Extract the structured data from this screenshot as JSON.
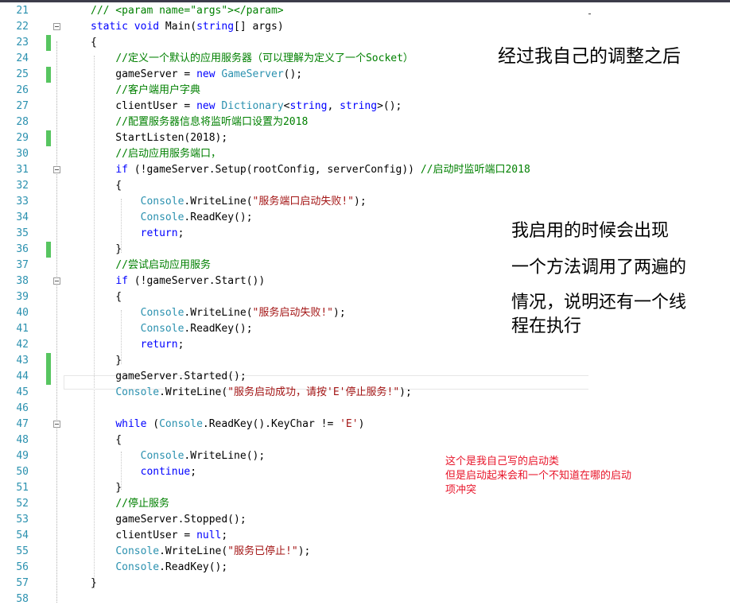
{
  "editor": {
    "lines": [
      {
        "num": "21",
        "changed": false,
        "fold": false,
        "tokens": [
          {
            "t": "/// <param name=\"args\"></param>",
            "c": "cm"
          }
        ]
      },
      {
        "num": "22",
        "changed": false,
        "fold": true,
        "tokens": [
          {
            "t": "static",
            "c": "kw"
          },
          {
            "t": " "
          },
          {
            "t": "void",
            "c": "kw"
          },
          {
            "t": " Main("
          },
          {
            "t": "string",
            "c": "kw"
          },
          {
            "t": "[] args)"
          }
        ]
      },
      {
        "num": "23",
        "changed": true,
        "fold": false,
        "tokens": [
          {
            "t": "{"
          }
        ]
      },
      {
        "num": "24",
        "changed": false,
        "fold": false,
        "tokens": [
          {
            "t": "    "
          },
          {
            "t": "//定义一个默认的应用服务器（可以理解为定义了一个Socket）",
            "c": "cm"
          }
        ]
      },
      {
        "num": "25",
        "changed": true,
        "fold": false,
        "tokens": [
          {
            "t": "    gameServer = "
          },
          {
            "t": "new",
            "c": "kw"
          },
          {
            "t": " "
          },
          {
            "t": "GameServer",
            "c": "ty"
          },
          {
            "t": "();"
          }
        ]
      },
      {
        "num": "26",
        "changed": false,
        "fold": false,
        "tokens": [
          {
            "t": "    "
          },
          {
            "t": "//客户端用户字典",
            "c": "cm"
          }
        ]
      },
      {
        "num": "27",
        "changed": false,
        "fold": false,
        "tokens": [
          {
            "t": "    clientUser = "
          },
          {
            "t": "new",
            "c": "kw"
          },
          {
            "t": " "
          },
          {
            "t": "Dictionary",
            "c": "ty"
          },
          {
            "t": "<"
          },
          {
            "t": "string",
            "c": "kw"
          },
          {
            "t": ", "
          },
          {
            "t": "string",
            "c": "kw"
          },
          {
            "t": ">();"
          }
        ]
      },
      {
        "num": "28",
        "changed": false,
        "fold": false,
        "tokens": [
          {
            "t": "    "
          },
          {
            "t": "//配置服务器信息将监听端口设置为2018",
            "c": "cm"
          }
        ]
      },
      {
        "num": "29",
        "changed": true,
        "fold": false,
        "tokens": [
          {
            "t": "    StartListen(2018);"
          }
        ]
      },
      {
        "num": "30",
        "changed": false,
        "fold": false,
        "tokens": [
          {
            "t": "    "
          },
          {
            "t": "//启动应用服务端口，",
            "c": "cm"
          }
        ]
      },
      {
        "num": "31",
        "changed": false,
        "fold": true,
        "tokens": [
          {
            "t": "    "
          },
          {
            "t": "if",
            "c": "kw"
          },
          {
            "t": " (!gameServer.Setup(rootConfig, serverConfig)) "
          },
          {
            "t": "//启动时监听端口2018",
            "c": "cm"
          }
        ]
      },
      {
        "num": "32",
        "changed": false,
        "fold": false,
        "tokens": [
          {
            "t": "    {"
          }
        ]
      },
      {
        "num": "33",
        "changed": false,
        "fold": false,
        "tokens": [
          {
            "t": "        "
          },
          {
            "t": "Console",
            "c": "ty"
          },
          {
            "t": ".WriteLine("
          },
          {
            "t": "\"服务端口启动失败!\"",
            "c": "str"
          },
          {
            "t": ");"
          }
        ]
      },
      {
        "num": "34",
        "changed": false,
        "fold": false,
        "tokens": [
          {
            "t": "        "
          },
          {
            "t": "Console",
            "c": "ty"
          },
          {
            "t": ".ReadKey();"
          }
        ]
      },
      {
        "num": "35",
        "changed": false,
        "fold": false,
        "tokens": [
          {
            "t": "        "
          },
          {
            "t": "return",
            "c": "kw"
          },
          {
            "t": ";"
          }
        ]
      },
      {
        "num": "36",
        "changed": true,
        "fold": false,
        "tokens": [
          {
            "t": "    }"
          }
        ]
      },
      {
        "num": "37",
        "changed": false,
        "fold": false,
        "tokens": [
          {
            "t": "    "
          },
          {
            "t": "//尝试启动应用服务",
            "c": "cm"
          }
        ]
      },
      {
        "num": "38",
        "changed": false,
        "fold": true,
        "tokens": [
          {
            "t": "    "
          },
          {
            "t": "if",
            "c": "kw"
          },
          {
            "t": " (!gameServer.Start())"
          }
        ]
      },
      {
        "num": "39",
        "changed": false,
        "fold": false,
        "tokens": [
          {
            "t": "    {"
          }
        ]
      },
      {
        "num": "40",
        "changed": false,
        "fold": false,
        "tokens": [
          {
            "t": "        "
          },
          {
            "t": "Console",
            "c": "ty"
          },
          {
            "t": ".WriteLine("
          },
          {
            "t": "\"服务启动失败!\"",
            "c": "str"
          },
          {
            "t": ");"
          }
        ]
      },
      {
        "num": "41",
        "changed": false,
        "fold": false,
        "tokens": [
          {
            "t": "        "
          },
          {
            "t": "Console",
            "c": "ty"
          },
          {
            "t": ".ReadKey();"
          }
        ]
      },
      {
        "num": "42",
        "changed": false,
        "fold": false,
        "tokens": [
          {
            "t": "        "
          },
          {
            "t": "return",
            "c": "kw"
          },
          {
            "t": ";"
          }
        ]
      },
      {
        "num": "43",
        "changed": true,
        "fold": false,
        "tokens": [
          {
            "t": "    }"
          }
        ]
      },
      {
        "num": "44",
        "changed": true,
        "fold": false,
        "tokens": [
          {
            "t": "    gameServer.Started();"
          }
        ]
      },
      {
        "num": "45",
        "changed": false,
        "fold": false,
        "tokens": [
          {
            "t": "    "
          },
          {
            "t": "Console",
            "c": "ty"
          },
          {
            "t": ".WriteLine("
          },
          {
            "t": "\"服务启动成功，请按'E'停止服务!\"",
            "c": "str"
          },
          {
            "t": ");"
          }
        ]
      },
      {
        "num": "46",
        "changed": false,
        "fold": false,
        "tokens": []
      },
      {
        "num": "47",
        "changed": false,
        "fold": true,
        "tokens": [
          {
            "t": "    "
          },
          {
            "t": "while",
            "c": "kw"
          },
          {
            "t": " ("
          },
          {
            "t": "Console",
            "c": "ty"
          },
          {
            "t": ".ReadKey().KeyChar != "
          },
          {
            "t": "'E'",
            "c": "str"
          },
          {
            "t": ")"
          }
        ]
      },
      {
        "num": "48",
        "changed": false,
        "fold": false,
        "tokens": [
          {
            "t": "    {"
          }
        ]
      },
      {
        "num": "49",
        "changed": false,
        "fold": false,
        "tokens": [
          {
            "t": "        "
          },
          {
            "t": "Console",
            "c": "ty"
          },
          {
            "t": ".WriteLine();"
          }
        ]
      },
      {
        "num": "50",
        "changed": false,
        "fold": false,
        "tokens": [
          {
            "t": "        "
          },
          {
            "t": "continue",
            "c": "kw"
          },
          {
            "t": ";"
          }
        ]
      },
      {
        "num": "51",
        "changed": false,
        "fold": false,
        "tokens": [
          {
            "t": "    }"
          }
        ]
      },
      {
        "num": "52",
        "changed": false,
        "fold": false,
        "tokens": [
          {
            "t": "    "
          },
          {
            "t": "//停止服务",
            "c": "cm"
          }
        ]
      },
      {
        "num": "53",
        "changed": false,
        "fold": false,
        "tokens": [
          {
            "t": "    gameServer.Stopped();"
          }
        ]
      },
      {
        "num": "54",
        "changed": false,
        "fold": false,
        "tokens": [
          {
            "t": "    clientUser = "
          },
          {
            "t": "null",
            "c": "kw"
          },
          {
            "t": ";"
          }
        ]
      },
      {
        "num": "55",
        "changed": false,
        "fold": false,
        "tokens": [
          {
            "t": "    "
          },
          {
            "t": "Console",
            "c": "ty"
          },
          {
            "t": ".WriteLine("
          },
          {
            "t": "\"服务已停止!\"",
            "c": "str"
          },
          {
            "t": ");"
          }
        ]
      },
      {
        "num": "56",
        "changed": false,
        "fold": false,
        "tokens": [
          {
            "t": "    "
          },
          {
            "t": "Console",
            "c": "ty"
          },
          {
            "t": ".ReadKey();"
          }
        ]
      },
      {
        "num": "57",
        "changed": false,
        "fold": false,
        "tokens": [
          {
            "t": "}"
          }
        ]
      },
      {
        "num": "58",
        "changed": false,
        "fold": false,
        "tokens": []
      }
    ]
  },
  "annotations": {
    "top_note": "经过我自己的调整之后",
    "middle_note_lines": [
      "我启用的时候会出现",
      "一个方法调用了两遍的",
      "情况，说明还有一个线",
      "程在执行"
    ],
    "red_note_lines": [
      "这个是我自己写的启动类",
      "但是启动起来会和一个不知道在哪的启动",
      "项冲突"
    ]
  },
  "colors": {
    "keyword": "#0000ff",
    "type": "#2b91af",
    "string": "#a31515",
    "comment": "#008000",
    "line_number": "#2b91af",
    "change_marker": "#57c560",
    "red_note": "#e8152a"
  }
}
